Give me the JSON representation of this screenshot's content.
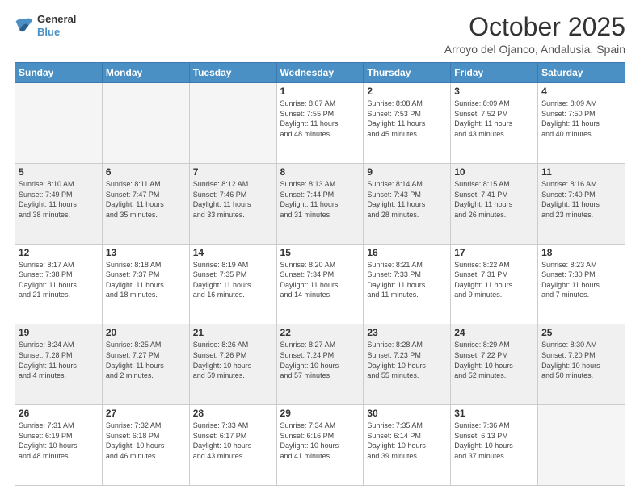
{
  "header": {
    "logo_line1": "General",
    "logo_line2": "Blue",
    "month": "October 2025",
    "location": "Arroyo del Ojanco, Andalusia, Spain"
  },
  "days_of_week": [
    "Sunday",
    "Monday",
    "Tuesday",
    "Wednesday",
    "Thursday",
    "Friday",
    "Saturday"
  ],
  "weeks": [
    [
      {
        "day": "",
        "info": ""
      },
      {
        "day": "",
        "info": ""
      },
      {
        "day": "",
        "info": ""
      },
      {
        "day": "1",
        "info": "Sunrise: 8:07 AM\nSunset: 7:55 PM\nDaylight: 11 hours\nand 48 minutes."
      },
      {
        "day": "2",
        "info": "Sunrise: 8:08 AM\nSunset: 7:53 PM\nDaylight: 11 hours\nand 45 minutes."
      },
      {
        "day": "3",
        "info": "Sunrise: 8:09 AM\nSunset: 7:52 PM\nDaylight: 11 hours\nand 43 minutes."
      },
      {
        "day": "4",
        "info": "Sunrise: 8:09 AM\nSunset: 7:50 PM\nDaylight: 11 hours\nand 40 minutes."
      }
    ],
    [
      {
        "day": "5",
        "info": "Sunrise: 8:10 AM\nSunset: 7:49 PM\nDaylight: 11 hours\nand 38 minutes."
      },
      {
        "day": "6",
        "info": "Sunrise: 8:11 AM\nSunset: 7:47 PM\nDaylight: 11 hours\nand 35 minutes."
      },
      {
        "day": "7",
        "info": "Sunrise: 8:12 AM\nSunset: 7:46 PM\nDaylight: 11 hours\nand 33 minutes."
      },
      {
        "day": "8",
        "info": "Sunrise: 8:13 AM\nSunset: 7:44 PM\nDaylight: 11 hours\nand 31 minutes."
      },
      {
        "day": "9",
        "info": "Sunrise: 8:14 AM\nSunset: 7:43 PM\nDaylight: 11 hours\nand 28 minutes."
      },
      {
        "day": "10",
        "info": "Sunrise: 8:15 AM\nSunset: 7:41 PM\nDaylight: 11 hours\nand 26 minutes."
      },
      {
        "day": "11",
        "info": "Sunrise: 8:16 AM\nSunset: 7:40 PM\nDaylight: 11 hours\nand 23 minutes."
      }
    ],
    [
      {
        "day": "12",
        "info": "Sunrise: 8:17 AM\nSunset: 7:38 PM\nDaylight: 11 hours\nand 21 minutes."
      },
      {
        "day": "13",
        "info": "Sunrise: 8:18 AM\nSunset: 7:37 PM\nDaylight: 11 hours\nand 18 minutes."
      },
      {
        "day": "14",
        "info": "Sunrise: 8:19 AM\nSunset: 7:35 PM\nDaylight: 11 hours\nand 16 minutes."
      },
      {
        "day": "15",
        "info": "Sunrise: 8:20 AM\nSunset: 7:34 PM\nDaylight: 11 hours\nand 14 minutes."
      },
      {
        "day": "16",
        "info": "Sunrise: 8:21 AM\nSunset: 7:33 PM\nDaylight: 11 hours\nand 11 minutes."
      },
      {
        "day": "17",
        "info": "Sunrise: 8:22 AM\nSunset: 7:31 PM\nDaylight: 11 hours\nand 9 minutes."
      },
      {
        "day": "18",
        "info": "Sunrise: 8:23 AM\nSunset: 7:30 PM\nDaylight: 11 hours\nand 7 minutes."
      }
    ],
    [
      {
        "day": "19",
        "info": "Sunrise: 8:24 AM\nSunset: 7:28 PM\nDaylight: 11 hours\nand 4 minutes."
      },
      {
        "day": "20",
        "info": "Sunrise: 8:25 AM\nSunset: 7:27 PM\nDaylight: 11 hours\nand 2 minutes."
      },
      {
        "day": "21",
        "info": "Sunrise: 8:26 AM\nSunset: 7:26 PM\nDaylight: 10 hours\nand 59 minutes."
      },
      {
        "day": "22",
        "info": "Sunrise: 8:27 AM\nSunset: 7:24 PM\nDaylight: 10 hours\nand 57 minutes."
      },
      {
        "day": "23",
        "info": "Sunrise: 8:28 AM\nSunset: 7:23 PM\nDaylight: 10 hours\nand 55 minutes."
      },
      {
        "day": "24",
        "info": "Sunrise: 8:29 AM\nSunset: 7:22 PM\nDaylight: 10 hours\nand 52 minutes."
      },
      {
        "day": "25",
        "info": "Sunrise: 8:30 AM\nSunset: 7:20 PM\nDaylight: 10 hours\nand 50 minutes."
      }
    ],
    [
      {
        "day": "26",
        "info": "Sunrise: 7:31 AM\nSunset: 6:19 PM\nDaylight: 10 hours\nand 48 minutes."
      },
      {
        "day": "27",
        "info": "Sunrise: 7:32 AM\nSunset: 6:18 PM\nDaylight: 10 hours\nand 46 minutes."
      },
      {
        "day": "28",
        "info": "Sunrise: 7:33 AM\nSunset: 6:17 PM\nDaylight: 10 hours\nand 43 minutes."
      },
      {
        "day": "29",
        "info": "Sunrise: 7:34 AM\nSunset: 6:16 PM\nDaylight: 10 hours\nand 41 minutes."
      },
      {
        "day": "30",
        "info": "Sunrise: 7:35 AM\nSunset: 6:14 PM\nDaylight: 10 hours\nand 39 minutes."
      },
      {
        "day": "31",
        "info": "Sunrise: 7:36 AM\nSunset: 6:13 PM\nDaylight: 10 hours\nand 37 minutes."
      },
      {
        "day": "",
        "info": ""
      }
    ]
  ]
}
